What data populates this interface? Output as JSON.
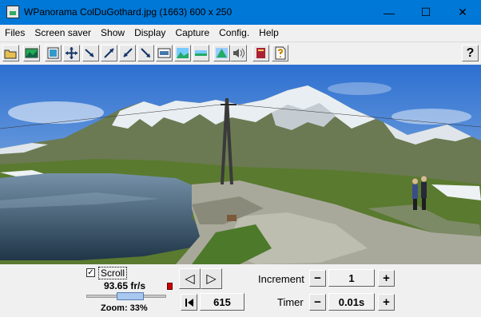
{
  "window": {
    "title": "WPanorama  ColDuGothard.jpg  (1663) 600 x 250",
    "minimize_glyph": "—",
    "maximize_glyph": "☐",
    "close_glyph": "✕"
  },
  "menu": [
    "Files",
    "Screen saver",
    "Show",
    "Display",
    "Capture",
    "Config.",
    "Help"
  ],
  "toolbar": {
    "help_glyph": "?",
    "buttons": [
      "open-folder-icon",
      "image-icon",
      "fit-window-icon",
      "expand-icon",
      "shrink-left-icon",
      "expand-diagonal-icon",
      "shrink-diagonal-icon",
      "expand-down-icon",
      "frame-icon",
      "landscape-icon",
      "flat-landscape-icon",
      "level-icon",
      "sound-icon",
      "book-icon",
      "help-document-icon",
      "help-icon"
    ]
  },
  "controls": {
    "scroll_label": "Scroll",
    "scroll_checked": true,
    "check_glyph": "✓",
    "fps": "93.65 fr/s",
    "zoom": "Zoom: 33%",
    "zoom_fraction": 0.33,
    "prev_glyph": "◁",
    "next_glyph": "▷",
    "position": "615",
    "increment_label": "Increment",
    "increment_value": "1",
    "timer_label": "Timer",
    "timer_value": "0.01s",
    "minus_glyph": "−",
    "plus_glyph": "+"
  }
}
